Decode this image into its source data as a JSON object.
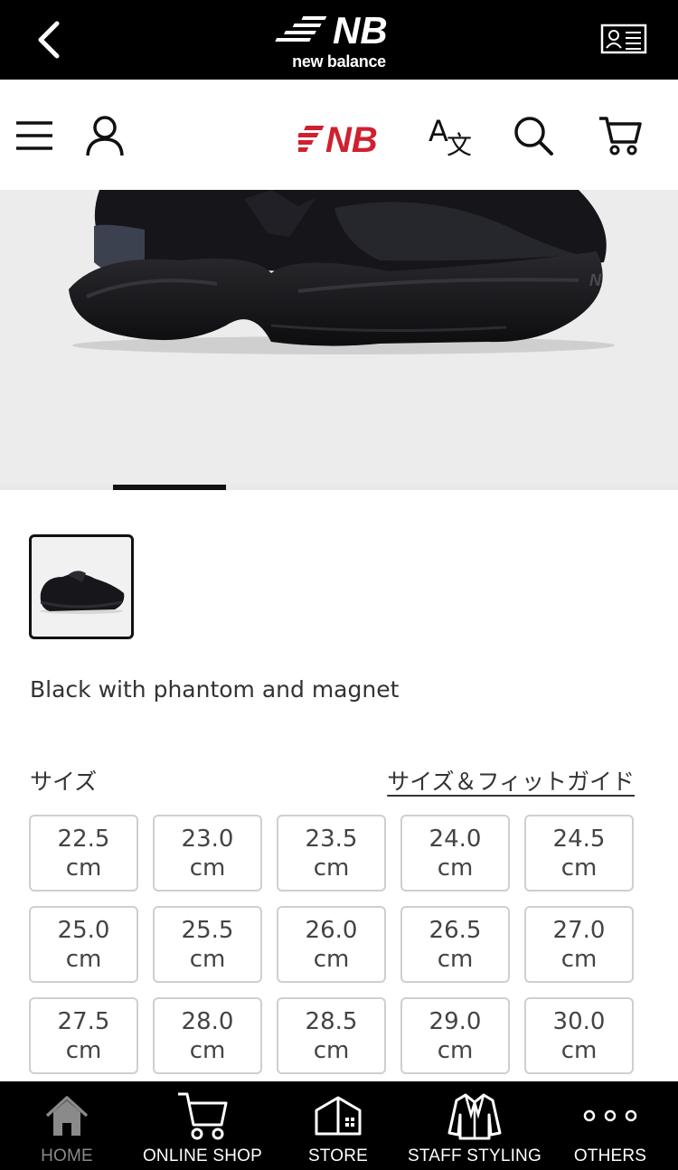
{
  "appbar": {
    "brand_text": "new balance"
  },
  "product": {
    "color_name": "Black with phantom and magnet"
  },
  "size_section": {
    "label": "サイズ",
    "guide_link": "サイズ＆フィットガイド",
    "sizes": [
      {
        "value": "22.5",
        "unit": "cm"
      },
      {
        "value": "23.0",
        "unit": "cm"
      },
      {
        "value": "23.5",
        "unit": "cm"
      },
      {
        "value": "24.0",
        "unit": "cm"
      },
      {
        "value": "24.5",
        "unit": "cm"
      },
      {
        "value": "25.0",
        "unit": "cm"
      },
      {
        "value": "25.5",
        "unit": "cm"
      },
      {
        "value": "26.0",
        "unit": "cm"
      },
      {
        "value": "26.5",
        "unit": "cm"
      },
      {
        "value": "27.0",
        "unit": "cm"
      },
      {
        "value": "27.5",
        "unit": "cm"
      },
      {
        "value": "28.0",
        "unit": "cm"
      },
      {
        "value": "28.5",
        "unit": "cm"
      },
      {
        "value": "29.0",
        "unit": "cm"
      },
      {
        "value": "30.0",
        "unit": "cm"
      }
    ]
  },
  "tabbar": {
    "tabs": [
      {
        "label": "HOME",
        "icon": "home-icon",
        "active": true
      },
      {
        "label": "ONLINE SHOP",
        "icon": "cart-icon",
        "active": false
      },
      {
        "label": "STORE",
        "icon": "store-icon",
        "active": false
      },
      {
        "label": "STAFF STYLING",
        "icon": "jacket-icon",
        "active": false
      },
      {
        "label": "OTHERS",
        "icon": "more-dots-icon",
        "active": false
      }
    ]
  },
  "colors": {
    "brand_red": "#d0202e",
    "bar_black": "#000000",
    "hero_bg": "#ececec"
  }
}
